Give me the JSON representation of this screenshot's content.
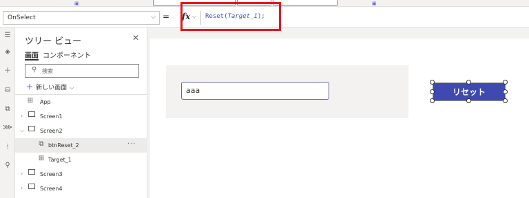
{
  "formula_bar": {
    "property": "OnSelect",
    "equals": "=",
    "fx_label": "fx",
    "formula_func": "Reset(",
    "formula_arg": "Target_1",
    "formula_end": ");"
  },
  "tree": {
    "title": "ツリー ビュー",
    "tab_screens": "画面",
    "tab_components": "コンポーネント",
    "search_placeholder": "検索",
    "new_screen": "新しい画面",
    "items": [
      {
        "label": "App"
      },
      {
        "label": "Screen1"
      },
      {
        "label": "Screen2"
      },
      {
        "label": "btnReset_2"
      },
      {
        "label": "Target_1"
      },
      {
        "label": "Screen3"
      },
      {
        "label": "Screen4"
      }
    ]
  },
  "canvas": {
    "input_value": "aaa",
    "button_label": "リセット"
  },
  "colors": {
    "accent": "#7160e8",
    "button": "#3f4ab0",
    "highlight": "#e8141c",
    "formula_text": "#3a56b0"
  }
}
